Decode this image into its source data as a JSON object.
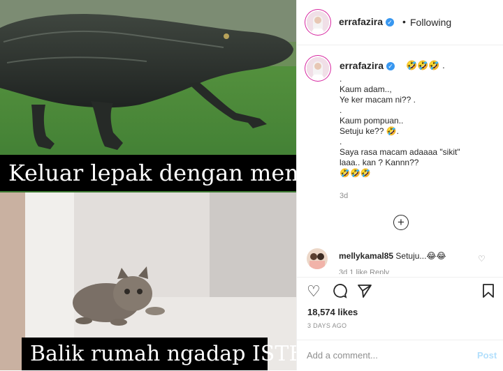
{
  "media": {
    "caption_top": "Keluar lepak dengan member",
    "caption_bottom": "Balik rumah ngadap ISTERI"
  },
  "header": {
    "username": "errafazira",
    "separator": "•",
    "follow_status": "Following",
    "more": "..."
  },
  "post_caption": {
    "username": "errafazira",
    "head_emoji": "🤣🤣🤣 .",
    "lines": [
      ".",
      "Kaum adam..,",
      "Ye ker macam ni?? .",
      ".",
      "Kaum pompuan..",
      "Setuju ke?? 🤣.",
      ".",
      "Saya rasa macam adaaaa \"sikit\"",
      "laaa.. kan ? Kannn??",
      "🤣🤣🤣"
    ],
    "time": "3d"
  },
  "comment": {
    "username": "mellykamal85",
    "text": "Setuju...😂😂",
    "meta": "3d   1 like   Reply"
  },
  "actions": {
    "likes": "18,574 likes",
    "date": "3 DAYS AGO"
  },
  "add_comment": {
    "placeholder": "Add a comment...",
    "post": "Post"
  },
  "icons": {
    "verified": "verified-badge-icon",
    "plus": "load-more-icon",
    "heart": "heart-icon",
    "comment": "comment-icon",
    "share": "share-icon",
    "bookmark": "bookmark-icon"
  },
  "colors": {
    "accent": "#3897f0",
    "muted": "#8e8e8e",
    "post_disabled": "#b2dffc"
  }
}
